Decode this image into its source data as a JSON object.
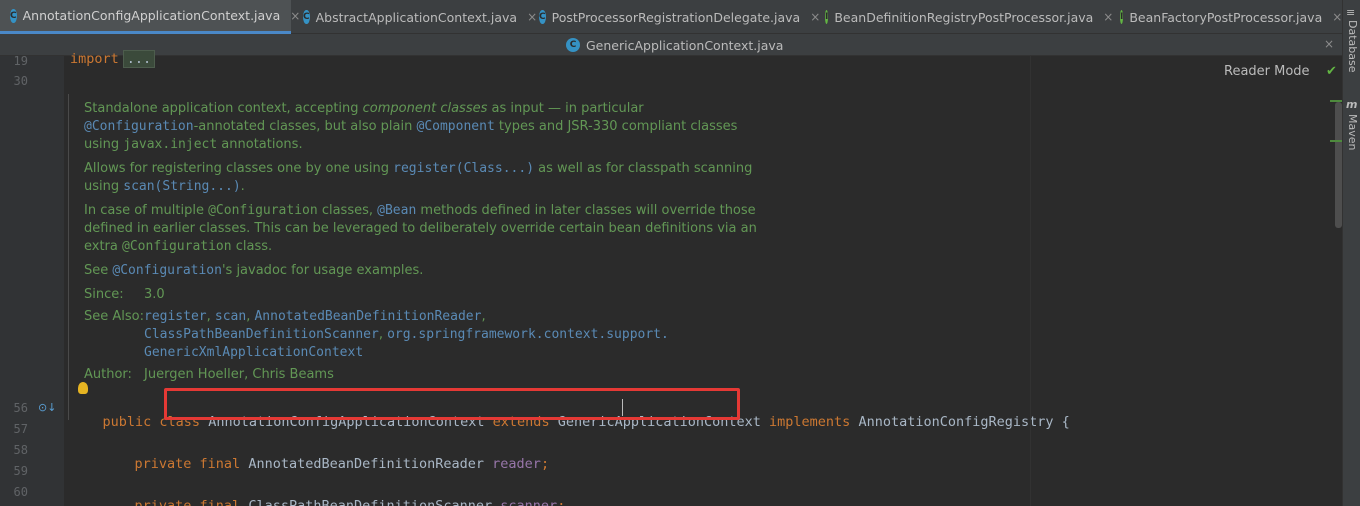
{
  "tabs": [
    {
      "label": "AnnotationConfigApplicationContext.java",
      "icon": "class-icon",
      "active": true
    },
    {
      "label": "AbstractApplicationContext.java",
      "icon": "class-icon"
    },
    {
      "label": "PostProcessorRegistrationDelegate.java",
      "icon": "class-icon"
    },
    {
      "label": "BeanDefinitionRegistryPostProcessor.java",
      "icon": "interface-icon"
    },
    {
      "label": "BeanFactoryPostProcessor.java",
      "icon": "interface-icon"
    }
  ],
  "second_tab": {
    "label": "GenericApplicationContext.java"
  },
  "close_glyph": "×",
  "line_numbers": {
    "l19": "19",
    "l30": "30",
    "l56": "56",
    "l57": "57",
    "l58": "58",
    "l59": "59",
    "l60": "60"
  },
  "import_line": {
    "keyword": "import",
    "ellipsis": "..."
  },
  "javadoc": {
    "p1_a": "Standalone application context, accepting ",
    "p1_em": "component classes",
    "p1_b": " as input — in particular ",
    "p1_code1": "@Configuration",
    "p1_c": "-annotated classes, but also plain ",
    "p1_code2": "@Component",
    "p1_d": " types and JSR-330 compliant classes using ",
    "p1_code3": "javax.inject",
    "p1_e": " annotations.",
    "p2_a": "Allows for registering classes one by one using ",
    "p2_code1": "register(Class...)",
    "p2_b": " as well as for classpath scanning using ",
    "p2_code2": "scan(String...)",
    "p2_c": ".",
    "p3_a": "In case of multiple ",
    "p3_code1": "@Configuration",
    "p3_b": " classes, ",
    "p3_code2": "@Bean",
    "p3_c": " methods defined in later classes will override those defined in earlier classes. This can be leveraged to deliberately override certain bean definitions via an extra ",
    "p3_code3": "@Configuration",
    "p3_d": " class.",
    "p4_a": "See ",
    "p4_code": "@Configuration",
    "p4_b": "'s javadoc for usage examples.",
    "since_label": "Since:",
    "since_value": "3.0",
    "see_also_label": "See Also:",
    "see_also_1": "register",
    "see_also_2": "scan",
    "see_also_3": "AnnotatedBeanDefinitionReader",
    "see_also_4": "ClassPathBeanDefinitionScanner",
    "see_also_5": "org.springframework.context.support.",
    "see_also_6": "GenericXmlApplicationContext",
    "author_label": "Author:",
    "author_value": "Juergen Hoeller, Chris Beams"
  },
  "code": {
    "line56_kw1": "public class ",
    "line56_name": "AnnotationConfigApplicationContext ",
    "line56_kw2": "extends ",
    "line56_super": "GenericApplicationContext ",
    "line56_kw3": "implements ",
    "line56_iface": "AnnotationConfigRegistry {",
    "line58_kw": "private final ",
    "line58_type": "AnnotatedBeanDefinitionReader ",
    "line58_field": "reader",
    "line58_end": ";",
    "line60_kw": "private final ",
    "line60_type": "ClassPathBeanDefinitionScanner ",
    "line60_field": "scanner",
    "line60_end": ";"
  },
  "reader_mode": "Reader Mode",
  "side_panel": {
    "database": "Database",
    "maven": "Maven"
  },
  "colors": {
    "accent": "#4a88c7",
    "highlight": "#e53935",
    "doc_green": "#629755",
    "keyword": "#cc7832"
  }
}
